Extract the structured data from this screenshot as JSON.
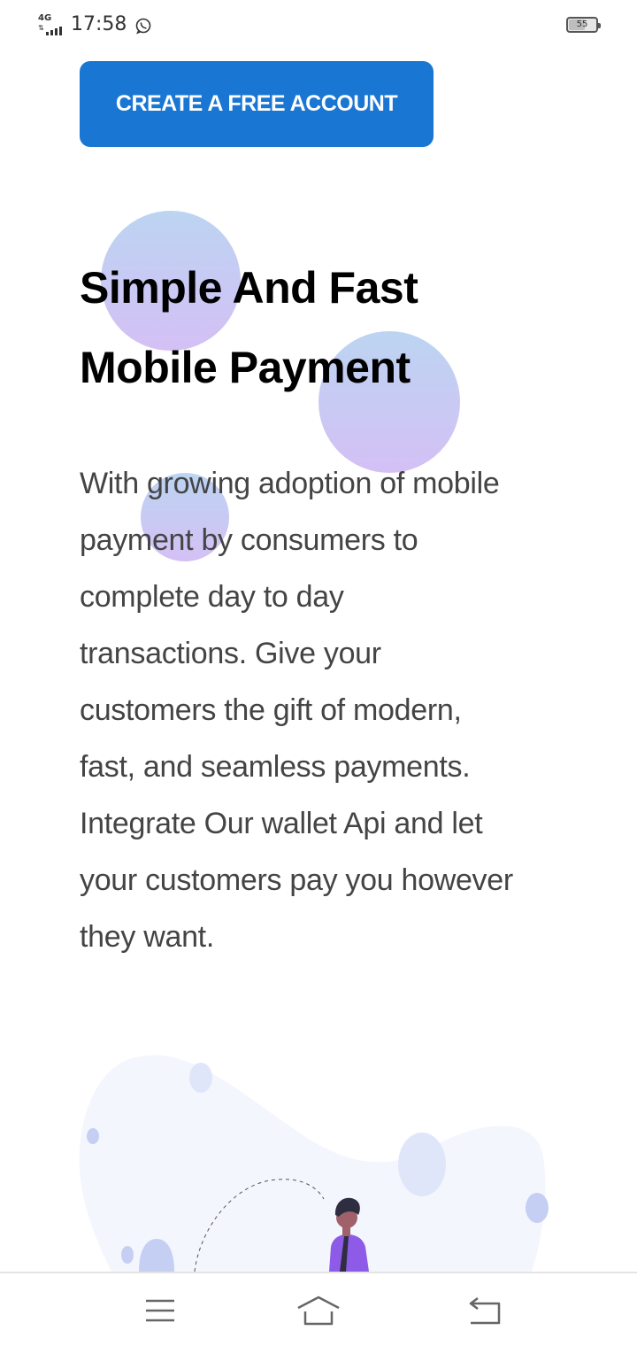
{
  "status_bar": {
    "network": "4G",
    "time": "17:58",
    "battery": "55",
    "battery_level": 0.55,
    "icons": [
      "signal-icon",
      "whatsapp-icon",
      "battery-icon"
    ]
  },
  "cta": {
    "label": "CREATE A FREE ACCOUNT"
  },
  "hero": {
    "title_lines": [
      "Simple And Fast",
      "Mobile Payment"
    ],
    "description_lines": [
      "With growing adoption of mobile",
      "payment by consumers to",
      "complete day to day",
      "transactions. Give your",
      "customers the gift of modern,",
      "fast, and seamless payments.",
      "Integrate Our wallet Api and let",
      "your customers pay you however",
      "they want."
    ]
  },
  "nav_bar": {
    "icons": [
      "menu-icon",
      "home-icon",
      "back-icon"
    ]
  },
  "colors": {
    "brand": "#1976d2",
    "heading": "#000000",
    "body_text": "#444444",
    "bubble_top": "#bcd4f2",
    "bubble_bottom": "#d4c0f5",
    "illustration_bg": "#f4f6fd",
    "accent_purple": "#8e5be8"
  }
}
